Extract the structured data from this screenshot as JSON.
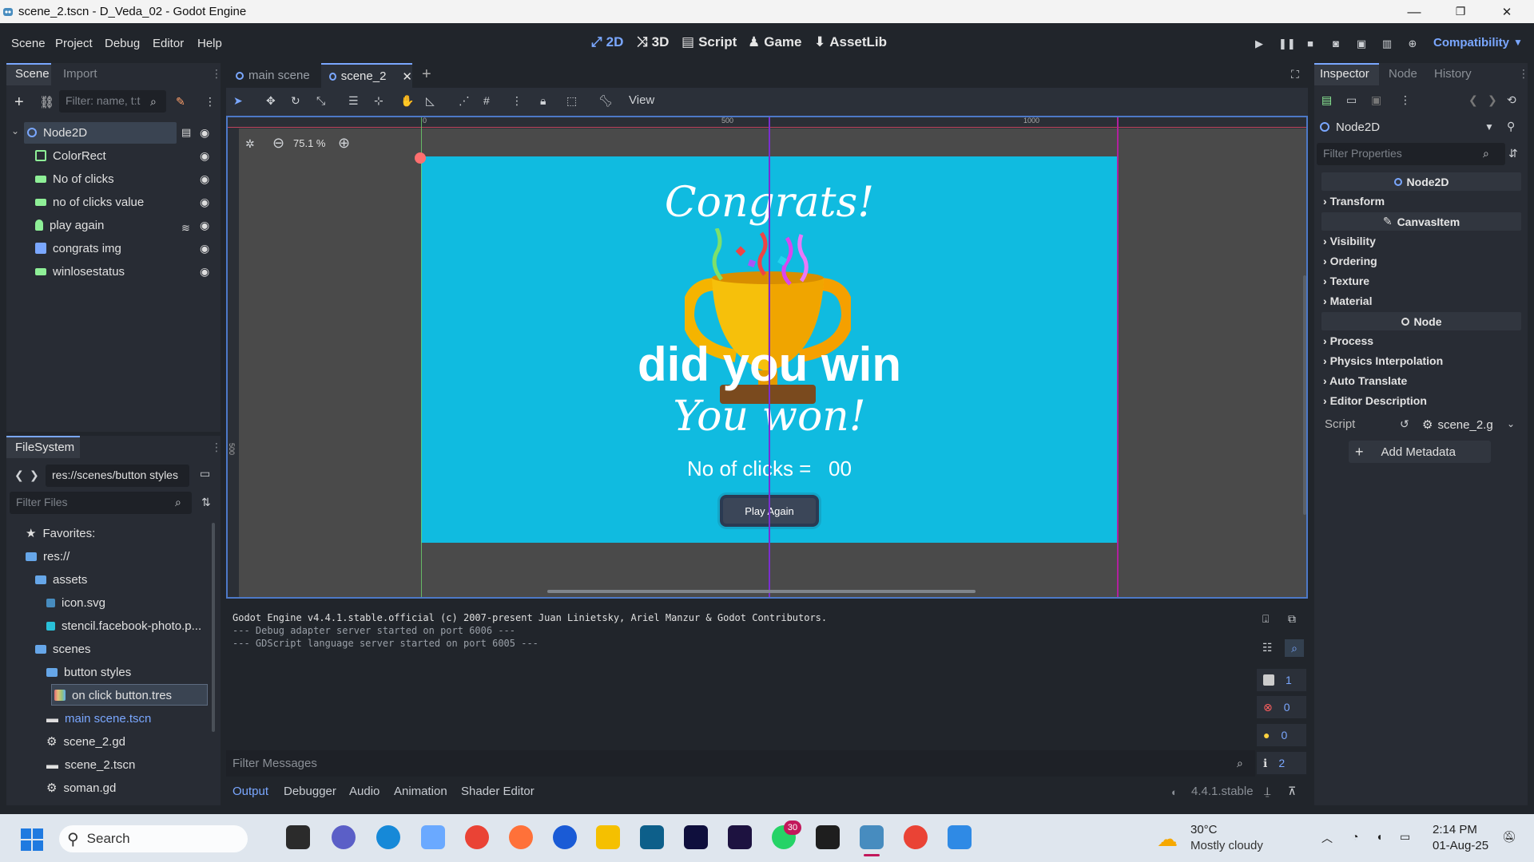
{
  "window": {
    "title": "scene_2.tscn - D_Veda_02 - Godot Engine",
    "minimize": "—",
    "maximize": "❐",
    "close": "✕"
  },
  "menu": [
    "Scene",
    "Project",
    "Debug",
    "Editor",
    "Help"
  ],
  "workspaces": [
    {
      "label": "2D",
      "icon": "2d-icon"
    },
    {
      "label": "3D",
      "icon": "3d-icon"
    },
    {
      "label": "Script",
      "icon": "script-icon"
    },
    {
      "label": "Game",
      "icon": "game-icon"
    },
    {
      "label": "AssetLib",
      "icon": "assetlib-icon"
    }
  ],
  "renderer": "Compatibility",
  "scene_dock": {
    "tabs": [
      "Scene",
      "Import"
    ],
    "filter_placeholder": "Filter: name, t:t",
    "nodes": [
      {
        "label": "Node2D",
        "icon": "node2d-icon",
        "color": "#7aa7ff"
      },
      {
        "label": "ColorRect",
        "icon": "colorrect-icon",
        "color": "#8eef97"
      },
      {
        "label": "No of clicks",
        "icon": "label-icon",
        "color": "#8eef97"
      },
      {
        "label": "no of clicks value",
        "icon": "label-icon",
        "color": "#8eef97"
      },
      {
        "label": "play again",
        "icon": "button-icon",
        "color": "#8eef97"
      },
      {
        "label": "congrats img",
        "icon": "texturerect-icon",
        "color": "#7aa7ff"
      },
      {
        "label": "winlosestatus",
        "icon": "label-icon",
        "color": "#8eef97"
      }
    ]
  },
  "filesystem": {
    "tab": "FileSystem",
    "path": "res://scenes/button styles",
    "filter_placeholder": "Filter Files",
    "items": [
      {
        "label": "Favorites:",
        "depth": 0
      },
      {
        "label": "res://",
        "depth": 0
      },
      {
        "label": "assets",
        "depth": 1
      },
      {
        "label": "icon.svg",
        "depth": 2
      },
      {
        "label": "stencil.facebook-photo.p...",
        "depth": 2
      },
      {
        "label": "scenes",
        "depth": 1
      },
      {
        "label": "button styles",
        "depth": 2
      },
      {
        "label": "on click button.tres",
        "depth": 3
      },
      {
        "label": "main scene.tscn",
        "depth": 2
      },
      {
        "label": "scene_2.gd",
        "depth": 2
      },
      {
        "label": "scene_2.tscn",
        "depth": 2
      },
      {
        "label": "soman.gd",
        "depth": 2
      }
    ]
  },
  "editor_tabs": [
    "main scene",
    "scene_2"
  ],
  "toolbar": {
    "view_label": "View",
    "zoom": "75.1 %"
  },
  "ruler": {
    "marks": [
      "0",
      "500",
      "1000"
    ],
    "side_mark": "500"
  },
  "scene_preview": {
    "congrats": "Congrats!",
    "title_label": "did you win",
    "status_label": "You won!",
    "clicks_label": "No of clicks =",
    "clicks_value": "00",
    "button_label": "Play Again",
    "bg_color": "#10bbe0"
  },
  "inspector": {
    "tabs": [
      "Inspector",
      "Node",
      "History"
    ],
    "node_selector": "Node2D",
    "filter_placeholder": "Filter Properties",
    "sections": [
      {
        "header": "Node2D",
        "categories": [
          "Transform"
        ]
      },
      {
        "header": "CanvasItem",
        "categories": [
          "Visibility",
          "Ordering",
          "Texture",
          "Material"
        ]
      },
      {
        "header": "Node",
        "categories": [
          "Process",
          "Physics Interpolation",
          "Auto Translate",
          "Editor Description"
        ]
      }
    ],
    "script_label": "Script",
    "script_value": "scene_2.g",
    "add_metadata": "Add Metadata"
  },
  "output": {
    "lines": [
      "Godot Engine v4.4.1.stable.official (c) 2007-present Juan Linietsky, Ariel Manzur & Godot Contributors.",
      "--- Debug adapter server started on port 6006 ---",
      "--- GDScript language server started on port 6005 ---"
    ],
    "filter_placeholder": "Filter Messages",
    "counters": {
      "messages": "1",
      "errors": "0",
      "warnings": "0",
      "info": "2"
    },
    "bottom_tabs": [
      "Output",
      "Debugger",
      "Audio",
      "Animation",
      "Shader Editor"
    ],
    "version": "4.4.1.stable"
  },
  "taskbar": {
    "search_placeholder": "Search",
    "weather_temp": "30°C",
    "weather_desc": "Mostly cloudy",
    "time": "2:14 PM",
    "date": "01-Aug-25",
    "whatsapp_badge": "30"
  }
}
